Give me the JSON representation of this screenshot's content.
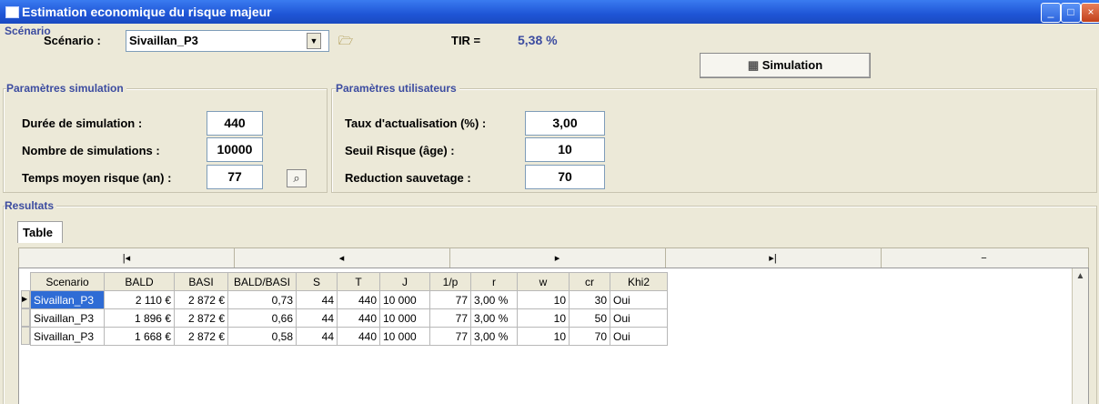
{
  "window": {
    "title": "Estimation economique du risque majeur",
    "controls": [
      "_",
      "□",
      "×"
    ]
  },
  "scenario": {
    "section": "Scénario",
    "label": "Scénario :",
    "value": "Sivaillan_P3",
    "tir_label": "TIR =",
    "tir_value": "5,38 %",
    "simulation_button": "Simulation"
  },
  "params_sim": {
    "section": "Paramètres simulation",
    "duration_label": "Durée de simulation :",
    "duration_value": "440",
    "count_label": "Nombre de simulations :",
    "count_value": "10000",
    "mean_label": "Temps moyen risque (an) :",
    "mean_value": "77"
  },
  "params_user": {
    "section": "Paramètres utilisateurs",
    "rate_label": "Taux d'actualisation (%) :",
    "rate_value": "3,00",
    "threshold_label": "Seuil Risque (âge) :",
    "threshold_value": "10",
    "rescue_label": "Reduction sauvetage :",
    "rescue_value": "70"
  },
  "results": {
    "section": "Resultats",
    "tab": "Table",
    "nav": [
      "|◂",
      "◂",
      "▸",
      "▸|",
      "−"
    ],
    "columns": [
      "Scenario",
      "BALD",
      "BASI",
      "BALD/BASI",
      "S",
      "T",
      "J",
      "1/p",
      "r",
      "w",
      "cr",
      "Khi2"
    ],
    "rows": [
      [
        "Sivaillan_P3",
        "2 110 €",
        "2 872 €",
        "0,73",
        "44",
        "440",
        "10 000",
        "77",
        "3,00 %",
        "10",
        "30",
        "Oui"
      ],
      [
        "Sivaillan_P3",
        "1 896 €",
        "2 872 €",
        "0,66",
        "44",
        "440",
        "10 000",
        "77",
        "3,00 %",
        "10",
        "50",
        "Oui"
      ],
      [
        "Sivaillan_P3",
        "1 668 €",
        "2 872 €",
        "0,58",
        "44",
        "440",
        "10 000",
        "77",
        "3,00 %",
        "10",
        "70",
        "Oui"
      ]
    ]
  },
  "colors": {
    "titlebar": "#1f55d6",
    "section": "#3c4ca0",
    "tir": "#3c4ca0",
    "selection": "#2f6cd5"
  }
}
